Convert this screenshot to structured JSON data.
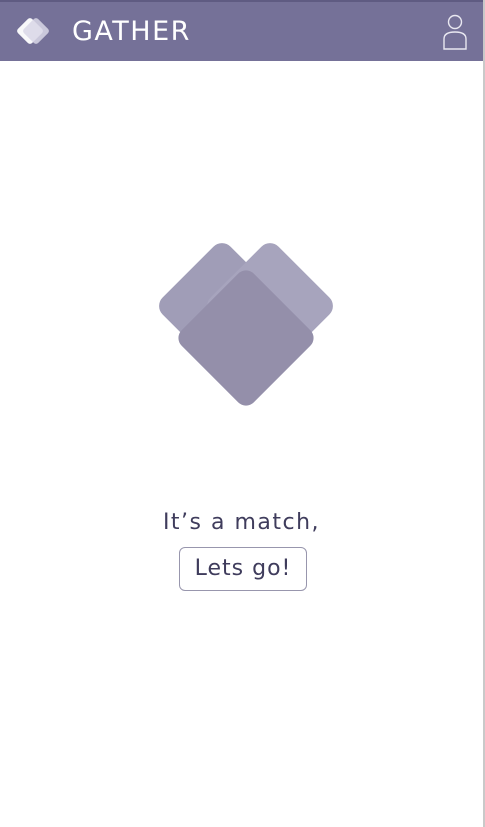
{
  "header": {
    "brand": "GATHER",
    "logo_icon": "diamond-logo-icon",
    "profile_icon": "user-profile-icon",
    "background_color": "#757198"
  },
  "main": {
    "hero_icon": "overlapping-diamonds-icon",
    "message": "It’s a match,",
    "button_label": "Lets go!",
    "accent_color": "#9793ad"
  }
}
